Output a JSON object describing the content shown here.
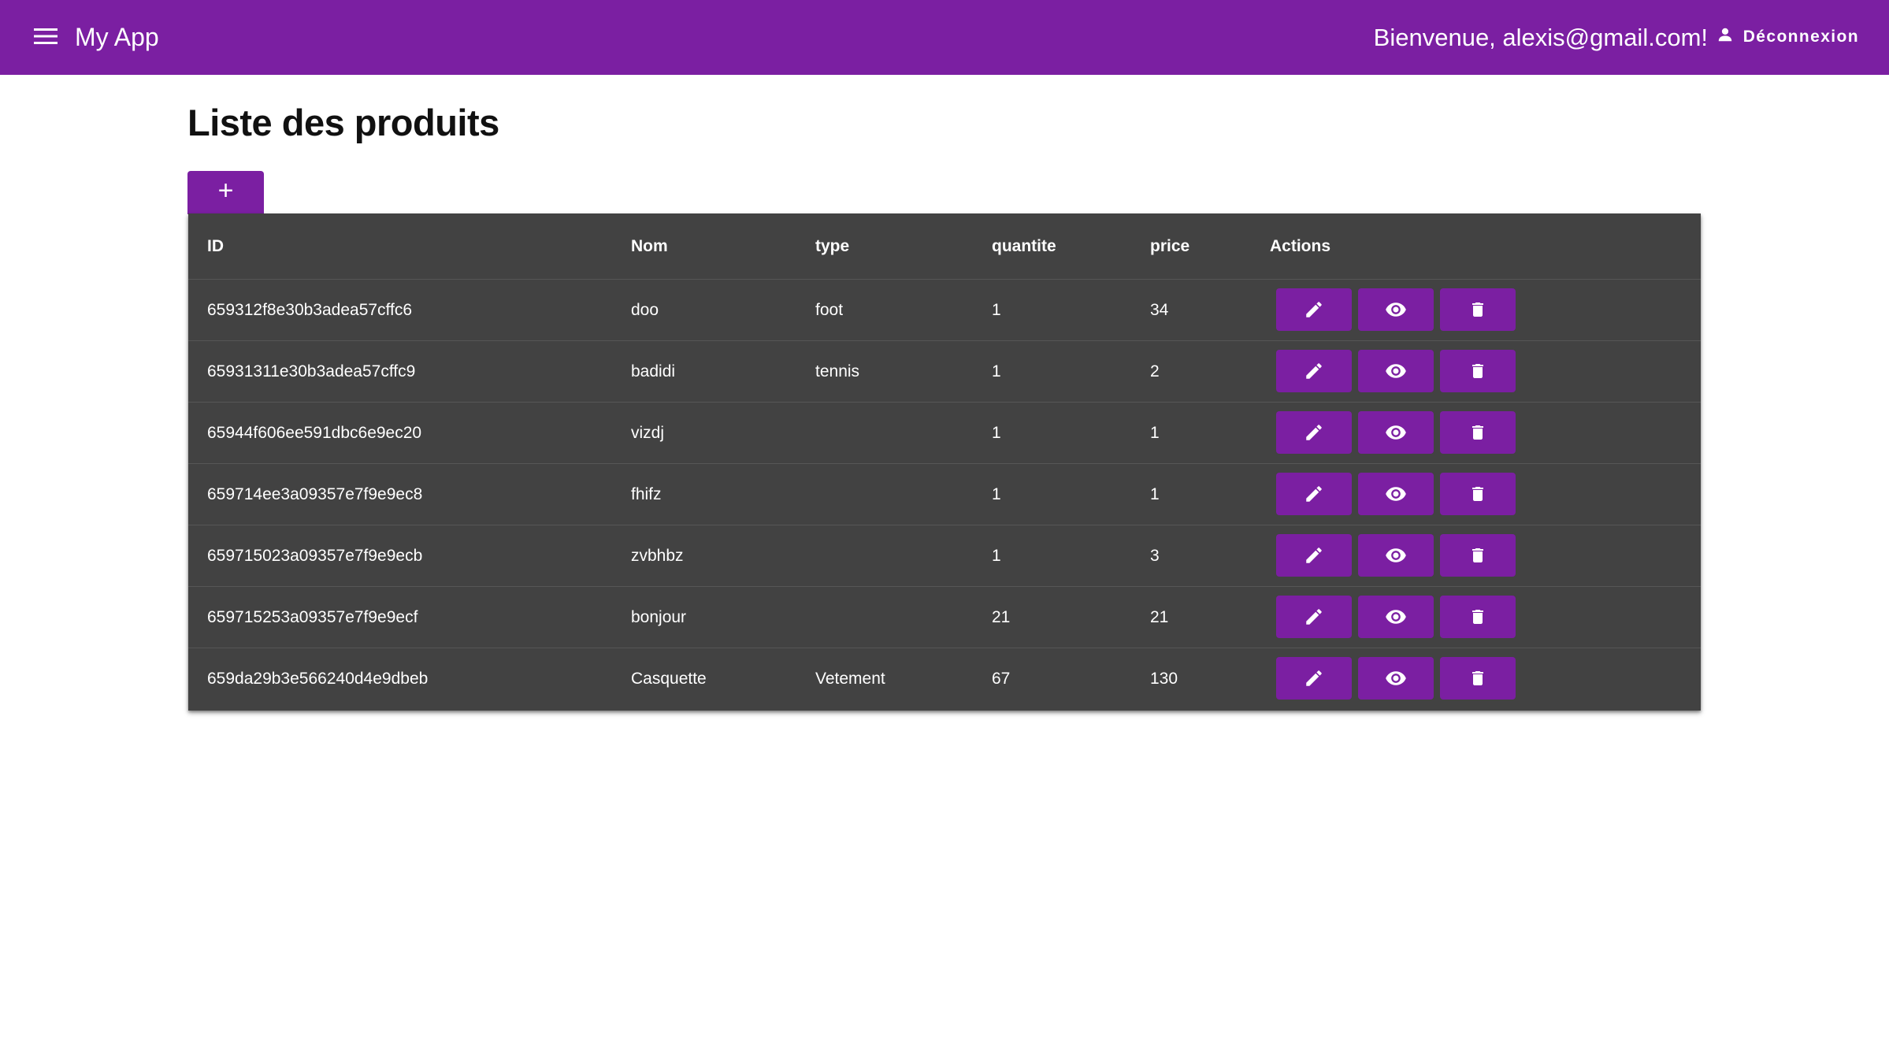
{
  "app": {
    "title": "My App",
    "welcome": "Bienvenue, alexis@gmail.com!",
    "logout_label": "Déconnexion",
    "menu_icon": "menu-icon",
    "logout_icon": "person-icon"
  },
  "page": {
    "title": "Liste des produits",
    "add_label": "+"
  },
  "colors": {
    "primary": "#7b1fa2",
    "table_background": "#424242",
    "text_on_dark": "#ffffff"
  },
  "table": {
    "headers": {
      "id": "ID",
      "nom": "Nom",
      "type": "type",
      "quantite": "quantite",
      "price": "price",
      "actions": "Actions"
    },
    "action_icons": [
      "edit-icon",
      "view-icon",
      "delete-icon"
    ],
    "rows": [
      {
        "id": "659312f8e30b3adea57cffc6",
        "nom": "doo",
        "type": "foot",
        "quantite": "1",
        "price": "34"
      },
      {
        "id": "65931311e30b3adea57cffc9",
        "nom": "badidi",
        "type": "tennis",
        "quantite": "1",
        "price": "2"
      },
      {
        "id": "65944f606ee591dbc6e9ec20",
        "nom": "vizdj",
        "type": "",
        "quantite": "1",
        "price": "1"
      },
      {
        "id": "659714ee3a09357e7f9e9ec8",
        "nom": "fhifz",
        "type": "",
        "quantite": "1",
        "price": "1"
      },
      {
        "id": "659715023a09357e7f9e9ecb",
        "nom": "zvbhbz",
        "type": "",
        "quantite": "1",
        "price": "3"
      },
      {
        "id": "659715253a09357e7f9e9ecf",
        "nom": "bonjour",
        "type": "",
        "quantite": "21",
        "price": "21"
      },
      {
        "id": "659da29b3e566240d4e9dbeb",
        "nom": "Casquette",
        "type": "Vetement",
        "quantite": "67",
        "price": "130"
      }
    ]
  }
}
